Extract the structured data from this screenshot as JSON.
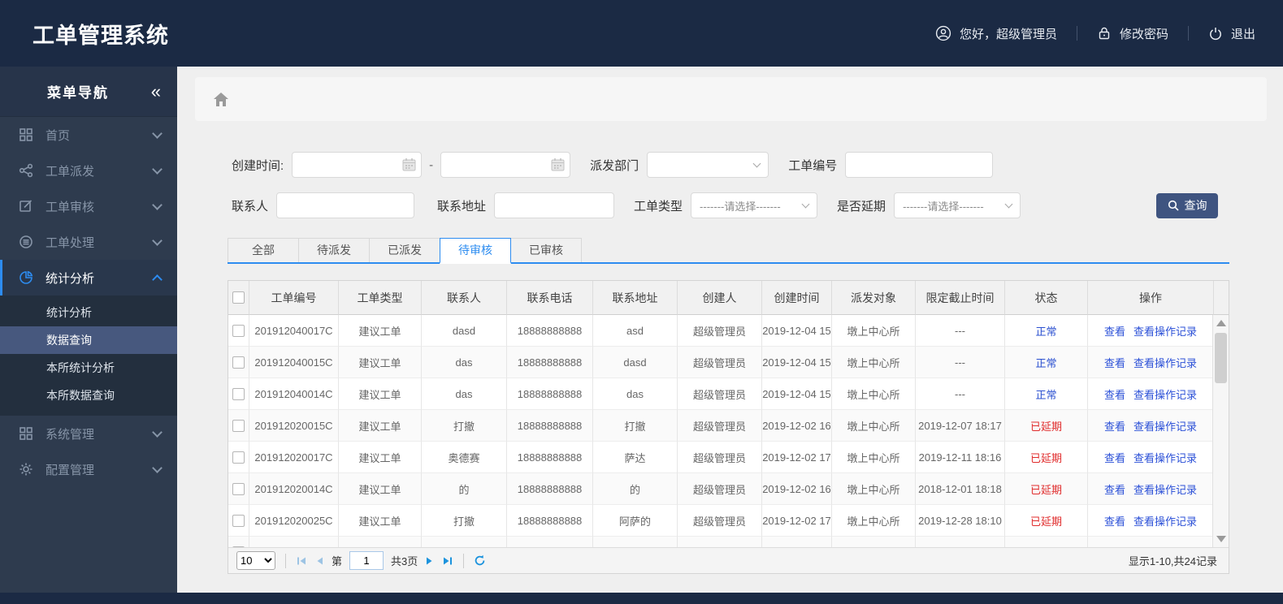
{
  "header": {
    "title": "工单管理系统",
    "greeting": "您好，超级管理员",
    "change_password": "修改密码",
    "logout": "退出"
  },
  "sidebar": {
    "title": "菜单导航",
    "collapse_glyph": "«",
    "items": [
      {
        "label": "首页",
        "icon": "grid-icon"
      },
      {
        "label": "工单派发",
        "icon": "share-icon"
      },
      {
        "label": "工单审核",
        "icon": "edit-icon"
      },
      {
        "label": "工单处理",
        "icon": "process-icon"
      },
      {
        "label": "统计分析",
        "icon": "pie-chart-icon",
        "active": true
      },
      {
        "label": "系统管理",
        "icon": "apps-icon"
      },
      {
        "label": "配置管理",
        "icon": "gear-icon"
      }
    ],
    "submenu": {
      "items": [
        "统计分析",
        "数据查询",
        "本所统计分析",
        "本所数据查询"
      ],
      "selected": "数据查询"
    }
  },
  "filters": {
    "create_time_label": "创建时间:",
    "range_separator": "-",
    "dispatch_dept_label": "派发部门",
    "order_no_label": "工单编号",
    "contact_label": "联系人",
    "address_label": "联系地址",
    "order_type_label": "工单类型",
    "delay_label": "是否延期",
    "select_placeholder": "-------请选择-------",
    "search_button": "查询"
  },
  "tabs": [
    {
      "label": "全部",
      "active": false
    },
    {
      "label": "待派发",
      "active": false
    },
    {
      "label": "已派发",
      "active": false
    },
    {
      "label": "待审核",
      "active": true
    },
    {
      "label": "已审核",
      "active": false
    }
  ],
  "table": {
    "columns": [
      "工单编号",
      "工单类型",
      "联系人",
      "联系电话",
      "联系地址",
      "创建人",
      "创建时间",
      "派发对象",
      "限定截止时间",
      "状态",
      "操作"
    ],
    "action_labels": [
      "查看",
      "查看操作记录"
    ],
    "rows": [
      {
        "order_no": "201912040017C",
        "order_type": "建议工单",
        "contact": "dasd",
        "phone": "18888888888",
        "address": "asd",
        "creator": "超级管理员",
        "created_at": "2019-12-04 15",
        "dispatch_target": "墩上中心所",
        "deadline": "---",
        "status": "正常",
        "status_type": "normal"
      },
      {
        "order_no": "201912040015C",
        "order_type": "建议工单",
        "contact": "das",
        "phone": "18888888888",
        "address": "dasd",
        "creator": "超级管理员",
        "created_at": "2019-12-04 15",
        "dispatch_target": "墩上中心所",
        "deadline": "---",
        "status": "正常",
        "status_type": "normal"
      },
      {
        "order_no": "201912040014C",
        "order_type": "建议工单",
        "contact": "das",
        "phone": "18888888888",
        "address": "das",
        "creator": "超级管理员",
        "created_at": "2019-12-04 15",
        "dispatch_target": "墩上中心所",
        "deadline": "---",
        "status": "正常",
        "status_type": "normal"
      },
      {
        "order_no": "201912020015C",
        "order_type": "建议工单",
        "contact": "打撤",
        "phone": "18888888888",
        "address": "打撤",
        "creator": "超级管理员",
        "created_at": "2019-12-02 16",
        "dispatch_target": "墩上中心所",
        "deadline": "2019-12-07 18:17",
        "status": "已延期",
        "status_type": "delayed"
      },
      {
        "order_no": "201912020017C",
        "order_type": "建议工单",
        "contact": "奥德赛",
        "phone": "18888888888",
        "address": "萨达",
        "creator": "超级管理员",
        "created_at": "2019-12-02 17",
        "dispatch_target": "墩上中心所",
        "deadline": "2019-12-11 18:16",
        "status": "已延期",
        "status_type": "delayed"
      },
      {
        "order_no": "201912020014C",
        "order_type": "建议工单",
        "contact": "的",
        "phone": "18888888888",
        "address": "的",
        "creator": "超级管理员",
        "created_at": "2019-12-02 16",
        "dispatch_target": "墩上中心所",
        "deadline": "2018-12-01 18:18",
        "status": "已延期",
        "status_type": "delayed"
      },
      {
        "order_no": "201912020025C",
        "order_type": "建议工单",
        "contact": "打撤",
        "phone": "18888888888",
        "address": "阿萨的",
        "creator": "超级管理员",
        "created_at": "2019-12-02 17",
        "dispatch_target": "墩上中心所",
        "deadline": "2019-12-28 18:10",
        "status": "已延期",
        "status_type": "delayed"
      },
      {
        "order_no": "",
        "order_type": "",
        "contact": "",
        "phone": "",
        "address": "",
        "creator": "",
        "created_at": "",
        "dispatch_target": "",
        "deadline": "",
        "status": "",
        "status_type": "none"
      }
    ]
  },
  "pagination": {
    "page_size": "10",
    "page_prefix": "第",
    "page_value": "1",
    "page_total": "共3页",
    "summary": "显示1-10,共24记录"
  }
}
